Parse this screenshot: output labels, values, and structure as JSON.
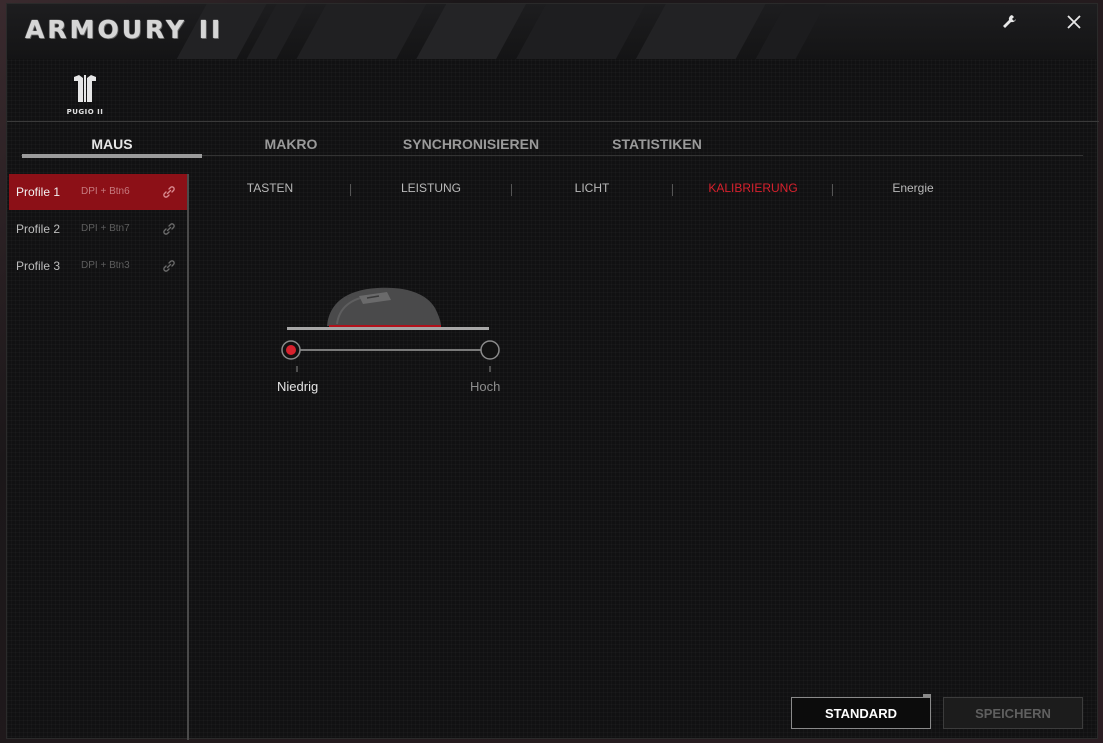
{
  "app": {
    "title": "ARMOURY II",
    "device_name": "PUGIO II"
  },
  "tabs": [
    {
      "label": "MAUS",
      "active": true
    },
    {
      "label": "MAKRO",
      "active": false
    },
    {
      "label": "SYNCHRONISIEREN",
      "active": false
    },
    {
      "label": "STATISTIKEN",
      "active": false
    }
  ],
  "profiles": [
    {
      "name": "Profile 1",
      "shortcut": "DPI + Btn6",
      "active": true
    },
    {
      "name": "Profile 2",
      "shortcut": "DPI + Btn7",
      "active": false
    },
    {
      "name": "Profile 3",
      "shortcut": "DPI + Btn3",
      "active": false
    }
  ],
  "subtabs": [
    {
      "label": "TASTEN",
      "active": false
    },
    {
      "label": "LEISTUNG",
      "active": false
    },
    {
      "label": "LICHT",
      "active": false
    },
    {
      "label": "KALIBRIERUNG",
      "active": true
    },
    {
      "label": "Energie",
      "active": false
    }
  ],
  "calibration": {
    "low_label": "Niedrig",
    "high_label": "Hoch",
    "selected": "Niedrig"
  },
  "buttons": {
    "standard": "STANDARD",
    "save": "SPEICHERN"
  },
  "colors": {
    "accent": "#d7212d",
    "active_profile_bg": "#8c1017"
  },
  "icons": {
    "settings": "wrench-icon",
    "close": "close-icon",
    "link": "link-icon",
    "device": "pugio-logo-icon"
  }
}
